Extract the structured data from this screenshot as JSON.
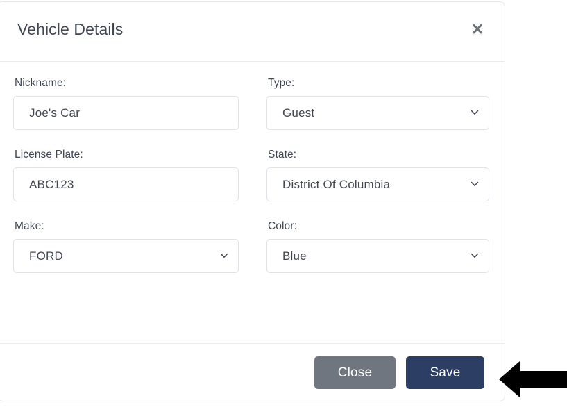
{
  "modal": {
    "title": "Vehicle Details",
    "close_icon": "close-icon",
    "close_icon_glyph": "✕",
    "fields": [
      {
        "key": "nickname",
        "label": "Nickname:",
        "control": "input",
        "value": "Joe's Car",
        "placeholder": "",
        "column": "left"
      },
      {
        "key": "type",
        "label": "Type:",
        "control": "select",
        "value": "Guest",
        "column": "right"
      },
      {
        "key": "license_plate",
        "label": "License Plate:",
        "control": "input",
        "value": "ABC123",
        "placeholder": "",
        "column": "left"
      },
      {
        "key": "state",
        "label": "State:",
        "control": "select",
        "value": "District Of Columbia",
        "column": "right"
      },
      {
        "key": "make",
        "label": "Make:",
        "control": "select",
        "value": "FORD",
        "column": "left"
      },
      {
        "key": "color",
        "label": "Color:",
        "control": "select",
        "value": "Blue",
        "column": "right"
      }
    ],
    "footer": {
      "close_label": "Close",
      "save_label": "Save"
    }
  },
  "annotation": {
    "arrow": "left-pointing-arrow",
    "points_to": "Save",
    "color": "#000000"
  },
  "colors": {
    "save_button": "#2c3e63",
    "close_button": "#6f7680",
    "text": "#3f4651",
    "field_border": "#dfe2e6",
    "divider": "#e9ecef",
    "annotation": "#000000"
  }
}
